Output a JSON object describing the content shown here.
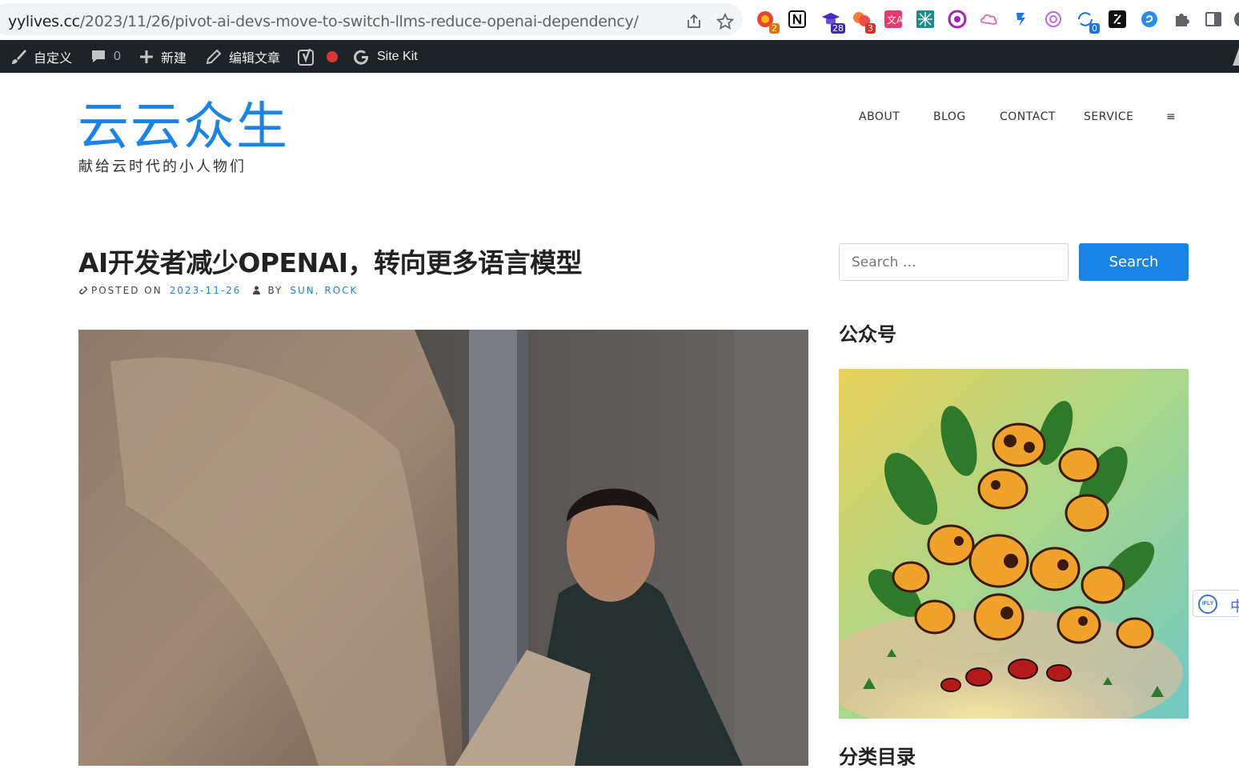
{
  "browser": {
    "url_host": "yylives.cc",
    "url_path": "/2023/11/26/pivot-ai-devs-move-to-switch-llms-reduce-openai-dependency/",
    "extensions": [
      {
        "icon": "chrome-ext-multicolor-icon",
        "badge": "2",
        "badge_color": "#e37400"
      },
      {
        "icon": "notion-icon",
        "badge": ""
      },
      {
        "icon": "graduation-cap-icon",
        "badge": "28",
        "badge_color": "#3c2bb0"
      },
      {
        "icon": "cloud-ext-icon",
        "badge": "3",
        "badge_color": "#d93025"
      },
      {
        "icon": "translate-icon",
        "badge": ""
      },
      {
        "icon": "grid-ext-icon",
        "badge": ""
      },
      {
        "icon": "purple-circle-ext-icon",
        "badge": ""
      },
      {
        "icon": "cloud-outline-ext-icon",
        "badge": ""
      },
      {
        "icon": "blue-arrow-ext-icon",
        "badge": ""
      },
      {
        "icon": "openai-icon",
        "badge": ""
      },
      {
        "icon": "sync-ext-icon",
        "badge": "0",
        "badge_color": "#1a73e8"
      },
      {
        "icon": "black-square-ext-icon",
        "badge": ""
      },
      {
        "icon": "blue-circle-ext-icon",
        "badge": ""
      },
      {
        "icon": "puzzle-icon",
        "badge": ""
      },
      {
        "icon": "side-panel-icon",
        "badge": ""
      }
    ]
  },
  "adminbar": {
    "customize": "自定义",
    "comments_count": "0",
    "new": "新建",
    "edit_post": "编辑文章",
    "site_kit": "Site Kit"
  },
  "site": {
    "title": "云云众生",
    "tagline": "献给云时代的小人物们"
  },
  "nav": {
    "items": [
      "ABOUT",
      "BLOG",
      "CONTACT",
      "SERVICE"
    ],
    "menu_icon": "≡"
  },
  "post": {
    "title": "AI开发者减少OPENAI，转向更多语言模型",
    "posted_on_label": "POSTED ON",
    "date": "2023-11-26",
    "by_label": "BY",
    "authors": "SUN, ROCK"
  },
  "sidebar": {
    "search_placeholder": "Search …",
    "search_button": "Search",
    "widget1_title": "公众号",
    "widget2_title": "分类目录"
  },
  "ifly": {
    "logo": "iFLY",
    "zh": "中"
  },
  "colors": {
    "accent": "#1a84e6",
    "adminbar": "#1d2327",
    "record_dot": "#d63638"
  }
}
